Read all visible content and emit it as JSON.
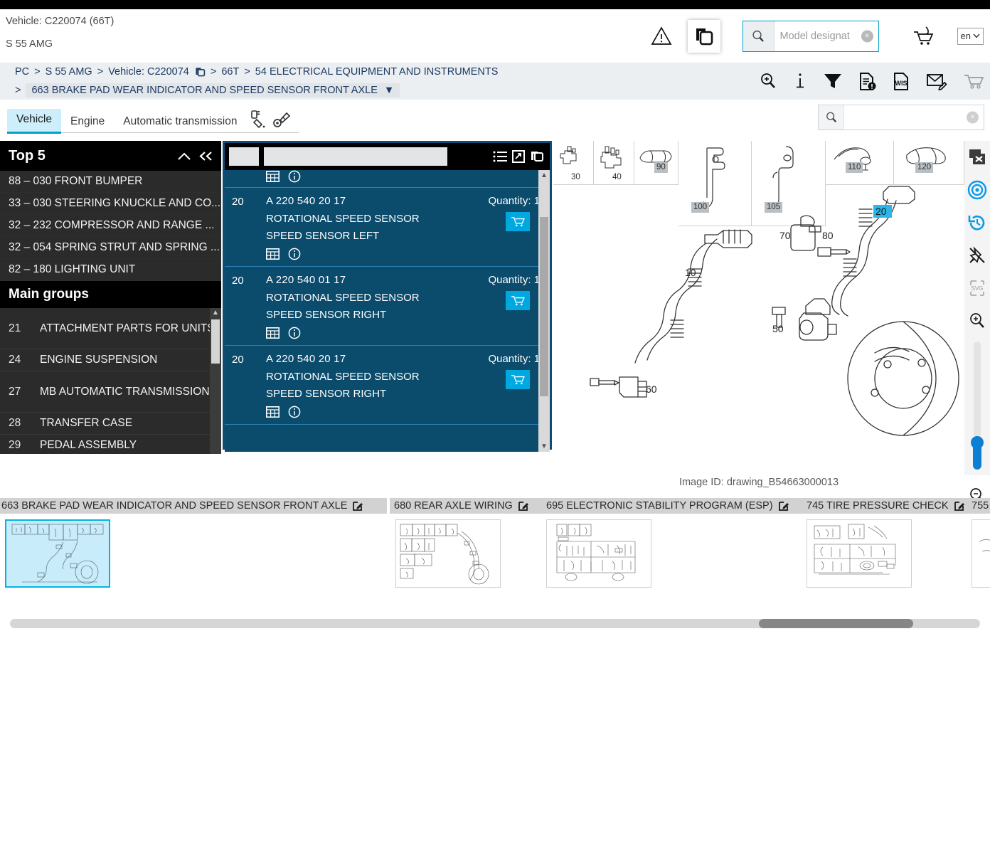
{
  "header": {
    "vehicle_line": "Vehicle: C220074 (66T)",
    "model_line": "S 55 AMG",
    "warning_icon": "warning-triangle-icon",
    "copy_icon": "copy-documents-icon",
    "search_icon": "search-icon",
    "search_placeholder": "Model designat",
    "search_value": "",
    "clear_label": "×",
    "cart_icon": "add-to-cart-icon",
    "language": "en"
  },
  "breadcrumb": {
    "row1": [
      {
        "label": "PC",
        "sep": ">"
      },
      {
        "label": "S 55 AMG",
        "sep": ">"
      },
      {
        "label": "Vehicle: C220074",
        "sep": ">",
        "icon": "copy-icon"
      },
      {
        "label": "66T",
        "sep": ">"
      },
      {
        "label": "54 ELECTRICAL EQUIPMENT AND INSTRUMENTS",
        "sep": ""
      }
    ],
    "row2_sep": ">",
    "row2_label": "663 BRAKE PAD WEAR INDICATOR AND SPEED SENSOR FRONT AXLE",
    "row2_caret": "▼",
    "tools": [
      "zoom-in-magnifier-icon",
      "info-icon",
      "filter-funnel-icon",
      "document-alert-icon",
      "wis-document-icon",
      "mail-edit-icon",
      "cart-icon"
    ]
  },
  "tabs": {
    "items": [
      {
        "label": "Vehicle",
        "active": true
      },
      {
        "label": "Engine",
        "active": false
      },
      {
        "label": "Automatic transmission",
        "active": false
      }
    ],
    "icons": [
      "paint-spray-icon",
      "fastener-bolt-icon"
    ],
    "search_value": "",
    "search_icon": "search-icon",
    "clear_label": "×"
  },
  "sidebar": {
    "top5_title": "Top 5",
    "collapse_up_icon": "chevron-up-icon",
    "collapse_left_icon": "double-chevron-left-icon",
    "top5_items": [
      "88 – 030 FRONT BUMPER",
      "33 – 030 STEERING KNUCKLE AND CO...",
      "32 – 232 COMPRESSOR AND RANGE ...",
      "32 – 054 SPRING STRUT AND SPRING ...",
      "82 – 180 LIGHTING UNIT"
    ],
    "maingroups_title": "Main groups",
    "maingroups": [
      {
        "num": "21",
        "label": "ATTACHMENT PARTS FOR UNITS"
      },
      {
        "num": "24",
        "label": "ENGINE SUSPENSION"
      },
      {
        "num": "27",
        "label": "MB AUTOMATIC TRANSMISSION"
      },
      {
        "num": "28",
        "label": "TRANSFER CASE"
      },
      {
        "num": "29",
        "label": "PEDAL ASSEMBLY"
      }
    ]
  },
  "parts_panel": {
    "header_icons": [
      "list-view-icon",
      "expand-icon",
      "copy-icon"
    ],
    "filter_value": "",
    "rows": [
      {
        "num": "20",
        "part_number": "A 220 540 20 17",
        "desc1": "ROTATIONAL SPEED SENSOR",
        "desc2": "SPEED SENSOR LEFT",
        "quantity_label": "Quantity: 1",
        "grid_icon": "table-grid-icon",
        "info_icon": "info-circle-icon",
        "cart_icon": "add-to-cart-icon"
      },
      {
        "num": "20",
        "part_number": "A 220 540 01 17",
        "desc1": "ROTATIONAL SPEED SENSOR",
        "desc2": "SPEED SENSOR RIGHT",
        "quantity_label": "Quantity: 1",
        "grid_icon": "table-grid-icon",
        "info_icon": "info-circle-icon",
        "cart_icon": "add-to-cart-icon"
      },
      {
        "num": "20",
        "part_number": "A 220 540 20 17",
        "desc1": "ROTATIONAL SPEED SENSOR",
        "desc2": "SPEED SENSOR RIGHT",
        "quantity_label": "Quantity: 1",
        "grid_icon": "table-grid-icon",
        "info_icon": "info-circle-icon",
        "cart_icon": "add-to-cart-icon"
      }
    ]
  },
  "drawing": {
    "image_id_label": "Image ID: drawing_B54663000013",
    "part_thumbnails": [
      "30",
      "40",
      "90",
      "100",
      "105",
      "110",
      "120"
    ],
    "callouts": [
      "10",
      "20",
      "50",
      "60",
      "70",
      "80"
    ],
    "highlighted_callout": "20",
    "highlight_color": "#29b6e8"
  },
  "right_toolbar": {
    "buttons": [
      "close-window-icon",
      "target-focus-icon",
      "history-reset-icon",
      "unpin-icon",
      "svg-export-icon",
      "zoom-in-icon"
    ],
    "zoom_out_icon": "zoom-out-icon",
    "accent_color": "#0b7fd4"
  },
  "bottom_tabs": {
    "items": [
      {
        "label": "663 BRAKE PAD WEAR INDICATOR AND SPEED SENSOR FRONT AXLE",
        "edit_icon": "edit-icon",
        "selected": true
      },
      {
        "label": "680 REAR AXLE WIRING",
        "edit_icon": "edit-icon",
        "selected": false
      },
      {
        "label": "695 ELECTRONIC STABILITY PROGRAM (ESP)",
        "edit_icon": "edit-icon",
        "selected": false
      },
      {
        "label": "745 TIRE PRESSURE CHECK",
        "edit_icon": "edit-icon",
        "selected": false
      },
      {
        "label": "755",
        "edit_icon": "",
        "selected": false
      }
    ]
  }
}
